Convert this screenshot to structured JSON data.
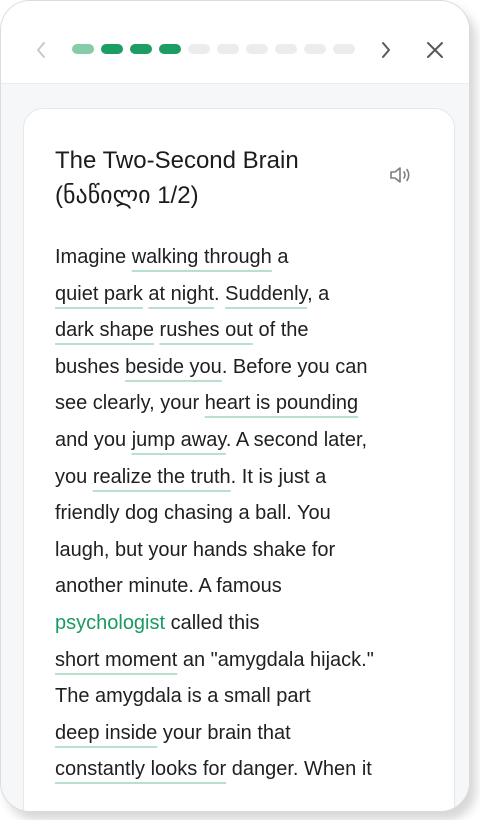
{
  "header": {
    "progress": {
      "total": 10,
      "completed": 3,
      "current_index": 0
    },
    "icons": {
      "prev": "chevron-left-icon",
      "next": "chevron-right-icon",
      "close": "close-icon"
    }
  },
  "lesson": {
    "title_line1": "The Two-Second Brain",
    "title_line2": "(ნაწილი 1/2)",
    "audio_icon": "speaker-icon"
  },
  "passage": {
    "l1": [
      "Imagine ",
      "walking through",
      " a"
    ],
    "l2": [
      "quiet park",
      " ",
      "at night",
      ". ",
      "Suddenly",
      ", a"
    ],
    "l3": [
      "dark shape",
      " ",
      "rushes out",
      " of the"
    ],
    "l4": [
      "bushes ",
      "beside you",
      ". Before you can"
    ],
    "l5": [
      "see clearly, your ",
      "heart is pounding"
    ],
    "l6": [
      "and you ",
      "jump away",
      ". A second later,"
    ],
    "l7": [
      "you ",
      "realize the truth",
      ". It is just a"
    ],
    "l8": [
      "friendly dog chasing a ball. You"
    ],
    "l9": [
      "laugh, but your hands shake for"
    ],
    "l10": [
      "another minute. A famous"
    ],
    "l11": [
      "psychologist",
      " called this"
    ],
    "l12": [
      "short moment",
      " an \"amygdala hijack.\""
    ],
    "l13": [
      "The amygdala is a small part"
    ],
    "l14": [
      "deep inside",
      " your brain that"
    ],
    "l15": [
      "constantly looks for",
      " danger. When it"
    ]
  },
  "colors": {
    "progress_done": "#1b9d63",
    "progress_current": "#86cca8",
    "progress_todo": "#ebecee",
    "keyword": "#1a9a63",
    "phrase_underline": "#b8e0cb"
  }
}
